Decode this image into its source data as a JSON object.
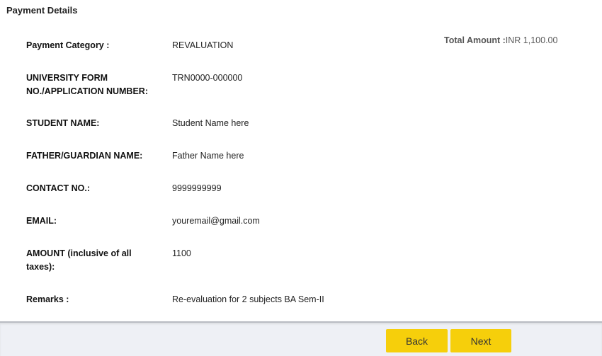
{
  "page": {
    "title": "Payment Details"
  },
  "total": {
    "label": "Total Amount :",
    "value": "INR 1,100.00"
  },
  "fields": [
    {
      "label": "Payment Category :",
      "value": "REVALUATION"
    },
    {
      "label": "UNIVERSITY FORM NO./APPLICATION NUMBER:",
      "value": "TRN0000-000000"
    },
    {
      "label": "STUDENT NAME:",
      "value": "Student Name here"
    },
    {
      "label": "FATHER/GUARDIAN NAME:",
      "value": "Father Name here"
    },
    {
      "label": "CONTACT NO.:",
      "value": "9999999999"
    },
    {
      "label": "EMAIL:",
      "value": "youremail@gmail.com"
    },
    {
      "label": "AMOUNT (inclusive of all taxes):",
      "value": "1100"
    },
    {
      "label": "Remarks :",
      "value": "Re-evaluation for 2 subjects BA Sem-II"
    }
  ],
  "footer": {
    "back_label": "Back",
    "next_label": "Next"
  }
}
